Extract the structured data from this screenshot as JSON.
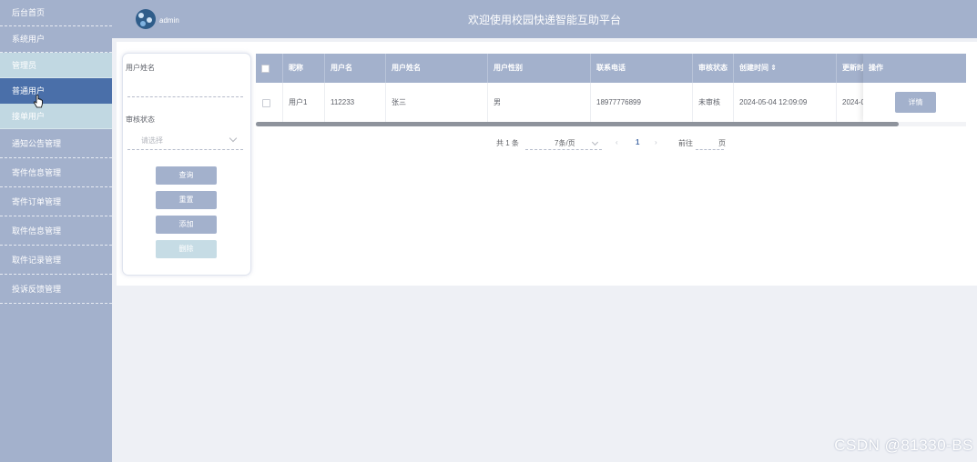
{
  "header": {
    "title": "欢迎使用校园快递智能互助平台",
    "user": "admin"
  },
  "sidebar": {
    "items": [
      {
        "label": "后台首页"
      },
      {
        "label": "系统用户"
      },
      {
        "label": "管理员"
      },
      {
        "label": "普通用户"
      },
      {
        "label": "接单用户"
      },
      {
        "label": "通知公告管理"
      },
      {
        "label": "寄件信息管理"
      },
      {
        "label": "寄件订单管理"
      },
      {
        "label": "取件信息管理"
      },
      {
        "label": "取件记录管理"
      },
      {
        "label": "投诉反馈管理"
      }
    ]
  },
  "search": {
    "name_label": "用户姓名",
    "status_label": "审核状态",
    "status_placeholder": "请选择",
    "buttons": {
      "query": "查询",
      "reset": "重置",
      "add": "添加",
      "delete": "删除"
    }
  },
  "table": {
    "headers": [
      "昵称",
      "用户名",
      "用户姓名",
      "用户性别",
      "联系电话",
      "审核状态",
      "创建时间 ⇕",
      "更新时",
      "操作"
    ],
    "rows": [
      {
        "nickname": "用户1",
        "username": "112233",
        "name": "张三",
        "gender": "男",
        "phone": "18977776899",
        "status": "未审核",
        "created": "2024-05-04 12:09:09",
        "updated": "2024-0",
        "action": "详情"
      }
    ]
  },
  "pagination": {
    "total": "共 1 条",
    "page_size": "7条/页",
    "prev": "‹",
    "current": "1",
    "next": "›",
    "goto_label": "前往",
    "goto_value": "",
    "page_unit": "页"
  },
  "watermark": "CSDN @81330-BS",
  "colors": {
    "sidebar": "#a3b1cc",
    "active": "#4a6fa9",
    "submenu": "#c1d8e2"
  }
}
